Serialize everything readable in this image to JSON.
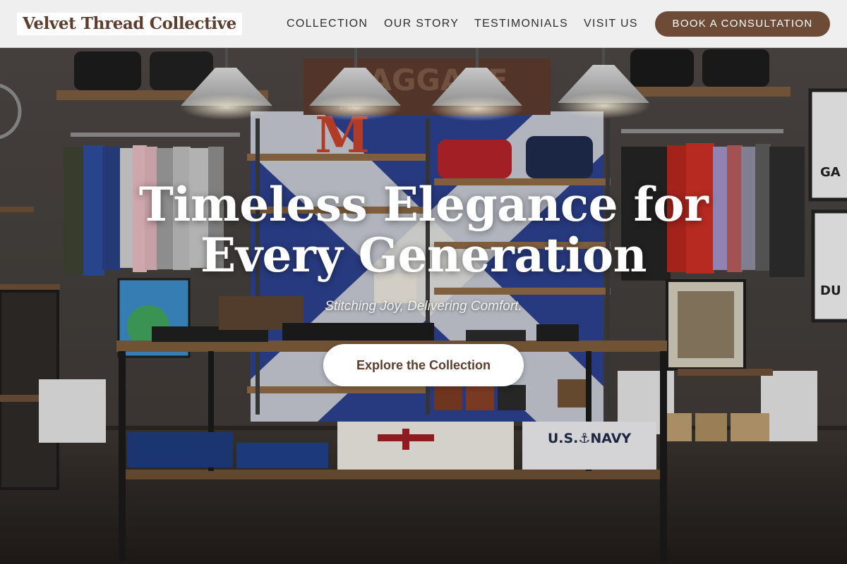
{
  "header": {
    "logo_text": "Velvet Thread Collective",
    "nav": {
      "collection": "COLLECTION",
      "story": "OUR STORY",
      "testimonials": "TESTIMONIALS",
      "visit": "VISIT US"
    },
    "cta_label": "BOOK A CONSULTATION"
  },
  "hero": {
    "title_line1": "Timeless Elegance for",
    "title_line2": "Every Generation",
    "tagline": "Stitching Joy, Delivering Comfort.",
    "button_label": "Explore the Collection",
    "sign_text": "BAGGAGE",
    "sign_sub": "MO",
    "right_sign_1": "GA",
    "right_sign_2": "DU",
    "shelf_letter": "M",
    "navy_shirt_text": "U.S.⚓NAVY"
  },
  "colors": {
    "brand_brown": "#6e4b36",
    "logo_brown": "#5c3d2e",
    "header_bg": "#f6f6f6",
    "text_white": "#ffffff"
  }
}
